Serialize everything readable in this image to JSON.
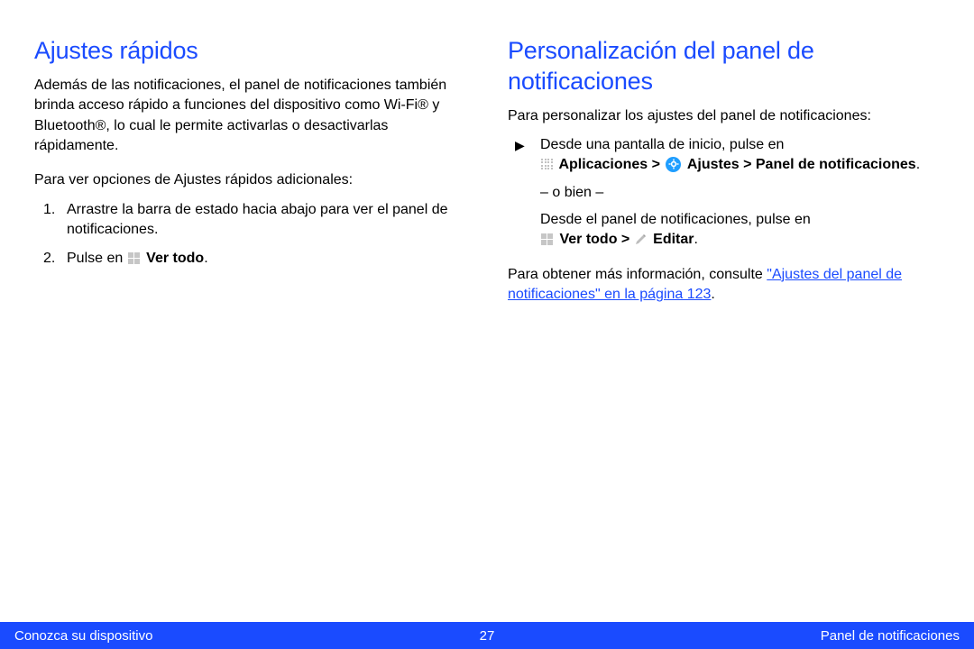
{
  "left": {
    "heading": "Ajustes rápidos",
    "intro": "Además de las notificaciones, el panel de notificaciones también brinda acceso rápido a funciones del dispositivo como Wi-Fi® y Bluetooth®, lo cual le permite activarlas o desactivarlas rápidamente.",
    "lead": "Para ver opciones de Ajustes rápidos adicionales:",
    "step1": "Arrastre la barra de estado hacia abajo para ver el panel de notificaciones.",
    "step2_prefix": "Pulse en ",
    "step2_bold": "Ver todo",
    "step2_suffix": "."
  },
  "right": {
    "heading": "Personalización del panel de notificaciones",
    "intro": "Para personalizar los ajustes del panel de notificaciones:",
    "bullet_line1a": "Desde una pantalla de inicio, pulse en",
    "apps_label": "Aplicaciones > ",
    "settings_label": " Ajustes > Panel de notificaciones",
    "period1": ".",
    "obien": "– o bien –",
    "alt_line": "Desde el panel de notificaciones, pulse en",
    "ver_todo_label": "Ver todo > ",
    "editar_label": " Editar",
    "period2": ".",
    "more_prefix": "Para obtener más información, consulte ",
    "more_link": "\"Ajustes del panel de notificaciones\" en la página 123",
    "more_suffix": "."
  },
  "footer": {
    "left": "Conozca su dispositivo",
    "center": "27",
    "right": "Panel de notificaciones"
  }
}
